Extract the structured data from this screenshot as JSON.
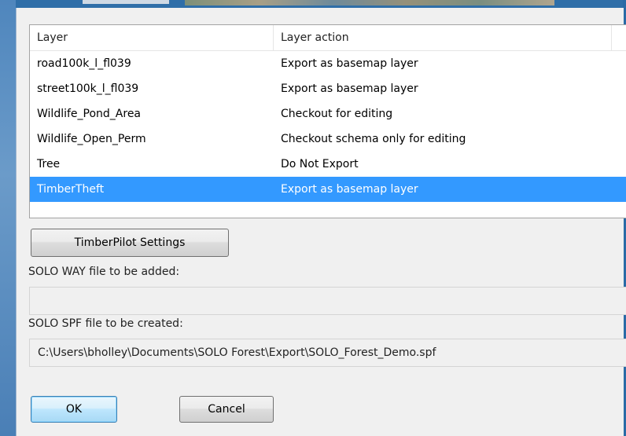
{
  "layers": {
    "columns": [
      "Layer",
      "Layer action"
    ],
    "rows": [
      {
        "layer": "road100k_l_fl039",
        "action": "Export as basemap layer",
        "selected": false
      },
      {
        "layer": "street100k_l_fl039",
        "action": "Export as basemap layer",
        "selected": false
      },
      {
        "layer": "Wildlife_Pond_Area",
        "action": "Checkout for editing",
        "selected": false
      },
      {
        "layer": "Wildlife_Open_Perm",
        "action": "Checkout schema only for editing",
        "selected": false
      },
      {
        "layer": "Tree",
        "action": "Do Not Export",
        "selected": false
      },
      {
        "layer": "TimberTheft",
        "action": "Export as basemap layer",
        "selected": true
      }
    ]
  },
  "timberpilot_button": "TimberPilot Settings",
  "way_file": {
    "label": "SOLO WAY file to be added:",
    "value": ""
  },
  "spf_file": {
    "label": "SOLO SPF file to be created:",
    "value": "C:\\Users\\bholley\\Documents\\SOLO Forest\\Export\\SOLO_Forest_Demo.spf"
  },
  "buttons": {
    "ok": "OK",
    "cancel": "Cancel"
  },
  "colors": {
    "selection": "#3399ff",
    "frame": "#2f6ea8"
  }
}
